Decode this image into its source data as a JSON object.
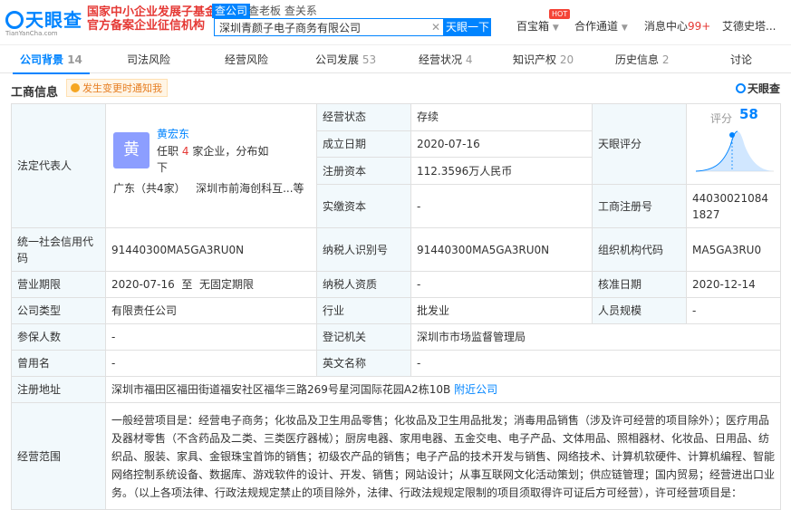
{
  "header": {
    "logo_text": "天眼查",
    "logo_sub": "TianYanCha.com",
    "promo_line1": "国家中小企业发展子基金",
    "promo_line2": "官方备案企业征信机构",
    "brand_tag": "查公司",
    "brand_sub": "查老板 查关系",
    "search_value": "深圳青颜子电子商务有限公司",
    "clear_icon": "✕",
    "search_button": "天眼一下",
    "nav": {
      "baibaoxiang": "百宝箱",
      "hot_badge": "HOT",
      "hezuo": "合作通道",
      "message": "消息中心",
      "message_count": "99+",
      "user": "艾德史塔..."
    }
  },
  "tabs": [
    {
      "label": "公司背景",
      "count": "14"
    },
    {
      "label": "司法风险",
      "count": ""
    },
    {
      "label": "经营风险",
      "count": ""
    },
    {
      "label": "公司发展",
      "count": "53"
    },
    {
      "label": "经营状况",
      "count": "4"
    },
    {
      "label": "知识产权",
      "count": "20"
    },
    {
      "label": "历史信息",
      "count": "2"
    },
    {
      "label": "讨论",
      "count": ""
    }
  ],
  "section": {
    "title": "工商信息",
    "notify": "发生变更时通知我",
    "logo": "天眼查"
  },
  "rep": {
    "label": "法定代表人",
    "avatar": "黄",
    "name": "黄宏东",
    "desc_pre": "任职",
    "desc_num": "4",
    "desc_post": "家企业，分布如下",
    "loc": "广东（共4家）",
    "loc2": "深圳市前海创科互...",
    "loc_more": "等"
  },
  "fields": {
    "status_label": "经营状态",
    "status_value": "存续",
    "score_label": "天眼评分",
    "score_text": "评分",
    "score_value": "58",
    "est_label": "成立日期",
    "est_value": "2020-07-16",
    "capital_label": "注册资本",
    "capital_value": "112.3596万人民币",
    "paid_label": "实缴资本",
    "paid_value": "-",
    "regno_label": "工商注册号",
    "regno_value": "440300210841827",
    "credit_label": "统一社会信用代码",
    "credit_value": "91440300MA5GA3RU0N",
    "taxid_label": "纳税人识别号",
    "taxid_value": "91440300MA5GA3RU0N",
    "org_label": "组织机构代码",
    "org_value": "MA5GA3RU0",
    "term_label": "营业期限",
    "term_value": "2020-07-16  至  无固定期限",
    "taxq_label": "纳税人资质",
    "taxq_value": "-",
    "approve_label": "核准日期",
    "approve_value": "2020-12-14",
    "type_label": "公司类型",
    "type_value": "有限责任公司",
    "industry_label": "行业",
    "industry_value": "批发业",
    "staff_label": "人员规模",
    "staff_value": "-",
    "insured_label": "参保人数",
    "insured_value": "-",
    "authority_label": "登记机关",
    "authority_value": "深圳市市场监督管理局",
    "former_label": "曾用名",
    "former_value": "-",
    "en_label": "英文名称",
    "en_value": "-",
    "address_label": "注册地址",
    "address_value": "深圳市福田区福田街道福安社区福华三路269号星河国际花园A2栋10B",
    "address_link": "附近公司",
    "scope_label": "经营范围",
    "scope_value": "一般经营项目是：经营电子商务；化妆品及卫生用品零售；化妆品及卫生用品批发；消毒用品销售（涉及许可经营的项目除外）；医疗用品及器材零售（不含药品及二类、三类医疗器械）；厨房电器、家用电器、五金交电、电子产品、文体用品、照相器材、化妆品、日用品、纺织品、服装、家具、金银珠宝首饰的销售；初级农产品的销售；电子产品的技术开发与销售、网络技术、计算机软硬件、计算机编程、智能网络控制系统设备、数据库、游戏软件的设计、开发、销售；网站设计；从事互联网文化活动策划；供应链管理；国内贸易；经营进出口业务。（以上各项法律、行政法规规定禁止的项目除外，法律、行政法规规定限制的项目须取得许可证后方可经营），许可经营项目是："
  }
}
